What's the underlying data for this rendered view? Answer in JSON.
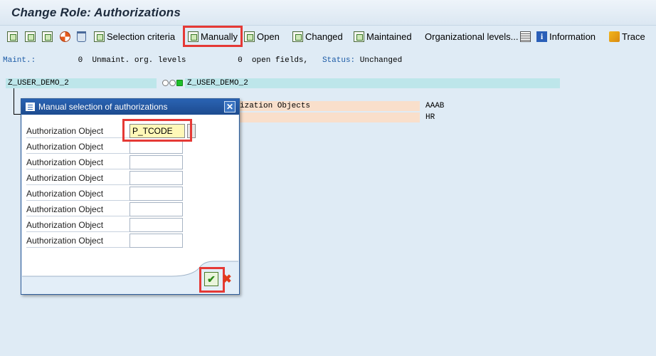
{
  "title": "Change Role: Authorizations",
  "toolbar": {
    "selection_criteria": "Selection criteria",
    "manually": "Manually",
    "open": "Open",
    "changed": "Changed",
    "maintained": "Maintained",
    "org_levels": "Organizational levels...",
    "information": "Information",
    "trace": "Trace"
  },
  "status": {
    "maint_label": "Maint.:",
    "maint_value": "0",
    "unmaint_label": "Unmaint. org. levels",
    "unmaint_value": "0",
    "open_fields": "open fields,",
    "status_label": "Status:",
    "status_value": "Unchanged"
  },
  "tree": {
    "role_left": "Z_USER_DEMO_2",
    "role_right": "Z_USER_DEMO_2",
    "row1_text": "ization Objects",
    "row1_value": "AAAB",
    "row2_value": "HR"
  },
  "dialog": {
    "title": "Manual selection of authorizations",
    "close_symbol": "✕",
    "rows": [
      {
        "label": "Authorization Object",
        "value": "P_TCODE"
      },
      {
        "label": "Authorization Object",
        "value": ""
      },
      {
        "label": "Authorization Object",
        "value": ""
      },
      {
        "label": "Authorization Object",
        "value": ""
      },
      {
        "label": "Authorization Object",
        "value": ""
      },
      {
        "label": "Authorization Object",
        "value": ""
      },
      {
        "label": "Authorization Object",
        "value": ""
      },
      {
        "label": "Authorization Object",
        "value": ""
      }
    ],
    "ok_symbol": "✔",
    "cancel_symbol": "✖"
  },
  "colors": {
    "background": "#dfebf5",
    "highlight": "#e53935",
    "dialog_title": "#2a63b3",
    "active_input": "#fff8b8"
  }
}
